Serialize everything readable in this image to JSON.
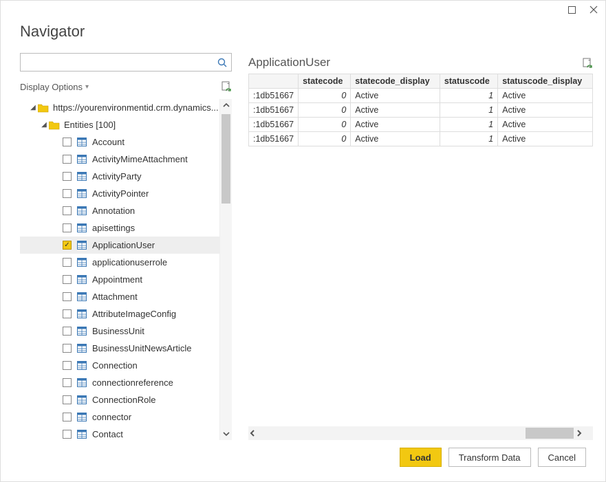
{
  "title": "Navigator",
  "search_placeholder": "",
  "display_options_label": "Display Options",
  "root_label": "https://yourenvironmentid.crm.dynamics...",
  "entities_group_label": "Entities [100]",
  "entities": [
    {
      "label": "Account",
      "checked": false
    },
    {
      "label": "ActivityMimeAttachment",
      "checked": false
    },
    {
      "label": "ActivityParty",
      "checked": false
    },
    {
      "label": "ActivityPointer",
      "checked": false
    },
    {
      "label": "Annotation",
      "checked": false
    },
    {
      "label": "apisettings",
      "checked": false
    },
    {
      "label": "ApplicationUser",
      "checked": true
    },
    {
      "label": "applicationuserrole",
      "checked": false
    },
    {
      "label": "Appointment",
      "checked": false
    },
    {
      "label": "Attachment",
      "checked": false
    },
    {
      "label": "AttributeImageConfig",
      "checked": false
    },
    {
      "label": "BusinessUnit",
      "checked": false
    },
    {
      "label": "BusinessUnitNewsArticle",
      "checked": false
    },
    {
      "label": "Connection",
      "checked": false
    },
    {
      "label": "connectionreference",
      "checked": false
    },
    {
      "label": "ConnectionRole",
      "checked": false
    },
    {
      "label": "connector",
      "checked": false
    },
    {
      "label": "Contact",
      "checked": false
    }
  ],
  "preview": {
    "title": "ApplicationUser",
    "columns": [
      "",
      "statecode",
      "statecode_display",
      "statuscode",
      "statuscode_display"
    ],
    "rows": [
      {
        "id": ":1db51667",
        "statecode": "0",
        "statecode_display": "Active",
        "statuscode": "1",
        "statuscode_display": "Active"
      },
      {
        "id": ":1db51667",
        "statecode": "0",
        "statecode_display": "Active",
        "statuscode": "1",
        "statuscode_display": "Active"
      },
      {
        "id": ":1db51667",
        "statecode": "0",
        "statecode_display": "Active",
        "statuscode": "1",
        "statuscode_display": "Active"
      },
      {
        "id": ":1db51667",
        "statecode": "0",
        "statecode_display": "Active",
        "statuscode": "1",
        "statuscode_display": "Active"
      }
    ]
  },
  "buttons": {
    "load": "Load",
    "transform": "Transform Data",
    "cancel": "Cancel"
  }
}
